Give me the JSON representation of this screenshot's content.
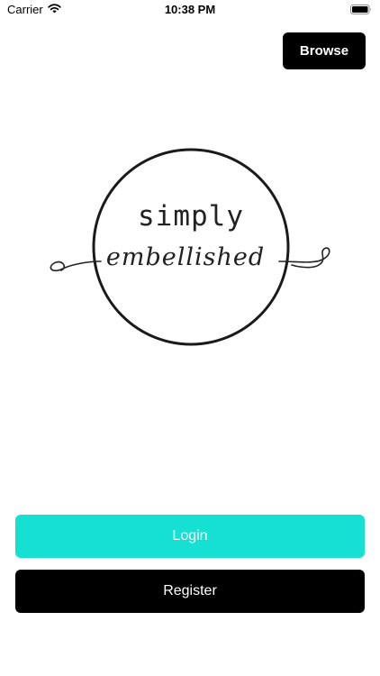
{
  "status_bar": {
    "carrier": "Carrier",
    "time": "10:38 PM"
  },
  "header": {
    "browse_label": "Browse"
  },
  "logo": {
    "line1": "simply",
    "line2": "embellished"
  },
  "actions": {
    "login_label": "Login",
    "register_label": "Register"
  },
  "colors": {
    "login": "#15e0d2",
    "dark": "#000000",
    "background": "#ffffff"
  },
  "icons": [
    "wifi-icon",
    "battery-icon"
  ]
}
